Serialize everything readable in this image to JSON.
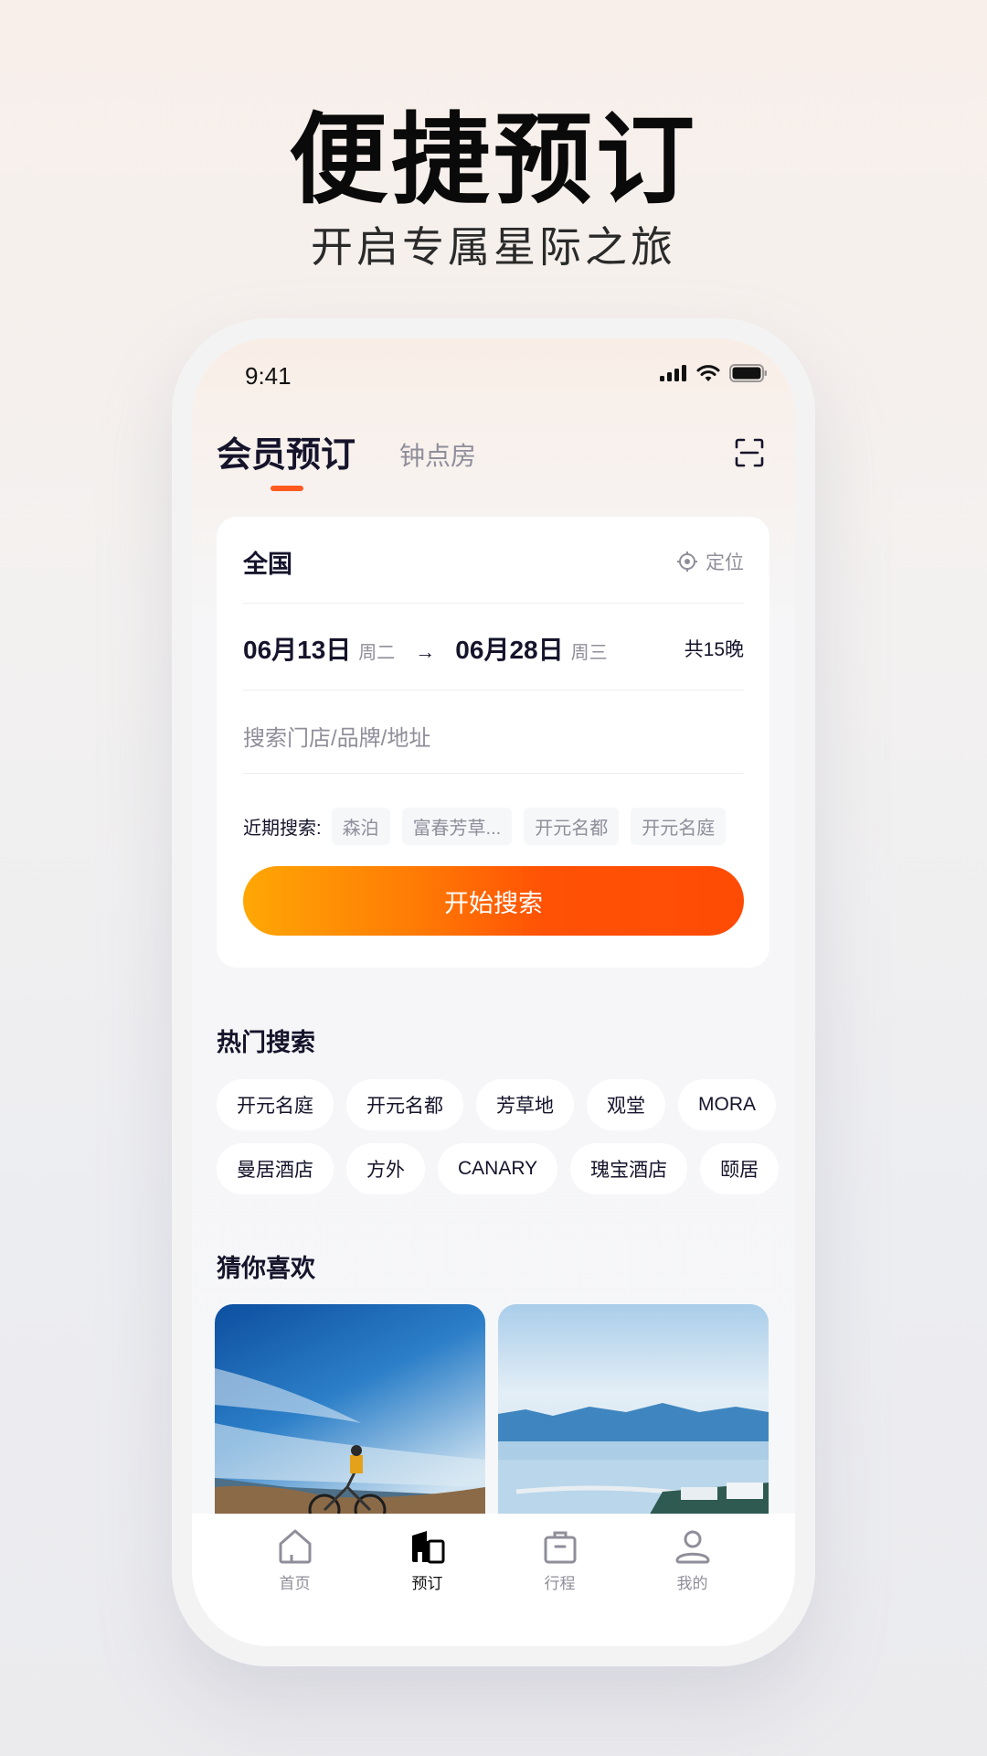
{
  "promo": {
    "headline": "便捷预订",
    "subheadline": "开启专属星际之旅"
  },
  "status_bar": {
    "time": "9:41",
    "icons": [
      "signal-icon",
      "wifi-icon",
      "battery-icon"
    ]
  },
  "header": {
    "tabs": [
      {
        "label": "会员预订",
        "active": true
      },
      {
        "label": "钟点房",
        "active": false
      }
    ],
    "scan_icon": "scan-icon",
    "accent_color": "#ff5a1f"
  },
  "booking_card": {
    "city": "全国",
    "locate_label": "定位",
    "checkin_date": "06月13日",
    "checkin_weekday": "周二",
    "arrow": "→",
    "checkout_date": "06月28日",
    "checkout_weekday": "周三",
    "nights": "共15晚",
    "search_placeholder": "搜索门店/品牌/地址",
    "recent_label": "近期搜索:",
    "recent_searches": [
      "森泊",
      "富春芳草...",
      "开元名都",
      "开元名庭"
    ],
    "search_button": "开始搜索"
  },
  "hot_search": {
    "title": "热门搜索",
    "rows": [
      [
        "开元名庭",
        "开元名都",
        "芳草地",
        "观堂",
        "MORA"
      ],
      [
        "曼居酒店",
        "方外",
        "CANARY",
        "瑰宝酒店",
        "颐居"
      ]
    ]
  },
  "recommend": {
    "title": "猜你喜欢",
    "images": [
      "cyclist-on-hill-image",
      "lake-resort-image"
    ]
  },
  "tabbar": {
    "items": [
      {
        "label": "首页",
        "icon": "home-icon",
        "active": false
      },
      {
        "label": "预订",
        "icon": "booking-icon",
        "active": true
      },
      {
        "label": "行程",
        "icon": "luggage-icon",
        "active": false
      },
      {
        "label": "我的",
        "icon": "profile-icon",
        "active": false
      }
    ]
  }
}
